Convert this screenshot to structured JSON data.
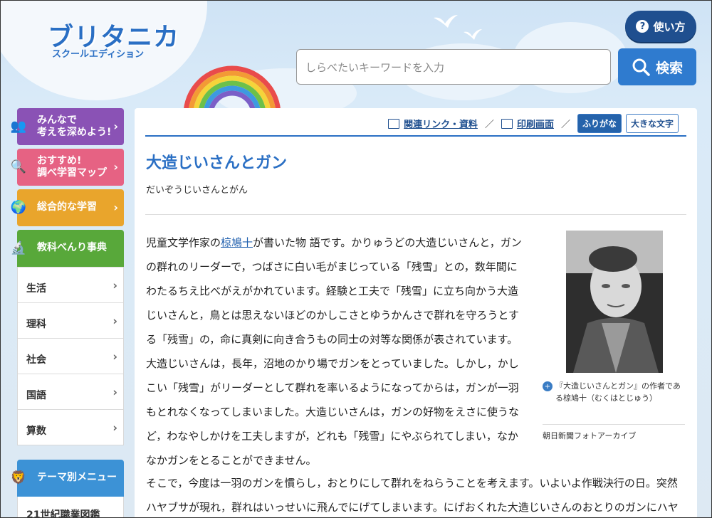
{
  "header": {
    "logo_main": "ブリタニカ",
    "logo_sub": "スクールエディション",
    "help_label": "使い方",
    "search_placeholder": "しらべたいキーワードを入力",
    "search_button": "検索"
  },
  "sidebar": {
    "categories": [
      {
        "label_line1": "みんなで",
        "label_line2": "考えを深めよう!"
      },
      {
        "label_line1": "おすすめ!",
        "label_line2": "調べ学習マップ"
      },
      {
        "label_line1": "総合的な学習",
        "label_line2": ""
      },
      {
        "label_line1": "教科べんり事典",
        "label_line2": ""
      }
    ],
    "subjects": [
      "生活",
      "理科",
      "社会",
      "国語",
      "算数"
    ],
    "theme_menu": "テーマ別メニュー",
    "theme_item": "21世紀職業図鑑"
  },
  "toolbar": {
    "related": "関連リンク・資料",
    "print": "印刷画面",
    "furigana": "ふりがな",
    "large_text": "大きな文字"
  },
  "article": {
    "title": "大造じいさんとガン",
    "reading": "だいぞうじいさんとがん",
    "p1_pre": "児童文学作家の",
    "p1_link": "椋鳩十",
    "p1_post": "が書いた物 語です。かりゅうどの大造じいさんと，ガンの群れのリーダーで，つばさに白い毛がまじっている「残雪」との，数年間にわたるちえ比べがえがかれています。経験と工夫で「残雪」に立ち向かう大造じいさんと，鳥とは思えないほどのかしこさとゆうかんさで群れを守ろうとする「残雪」の，命に真剣に向き合うもの同士の対等な関係が表されています。",
    "p2": "大造じいさんは，長年，沼地のかり場でガンをとっていました。しかし，かしこい「残雪」がリーダーとして群れを率いるようになってからは，ガンが一羽もとれなくなってしまいました。大造じいさんは，ガンの好物をえさに使うなど，わなやしかけを工夫しますが，どれも「残雪」にやぶられてしまい，なかなかガンをとることができません。",
    "p2_full": "そこで，今度は一羽のガンを慣らし，おとりにして群れをねらうことを考えます。いよいよ作戦決行の日。突然ハヤブサが現れ，群れはいっせいに飛んでにげてしまいます。にげおくれた大造じいさんのおとりのガンにハヤブサがおそいかかると，仲間を助けよ",
    "caption": "『大造じいさんとガン』の作者である椋鳩十（むくはとじゅう）",
    "credit": "朝日新聞フォトアーカイブ"
  }
}
